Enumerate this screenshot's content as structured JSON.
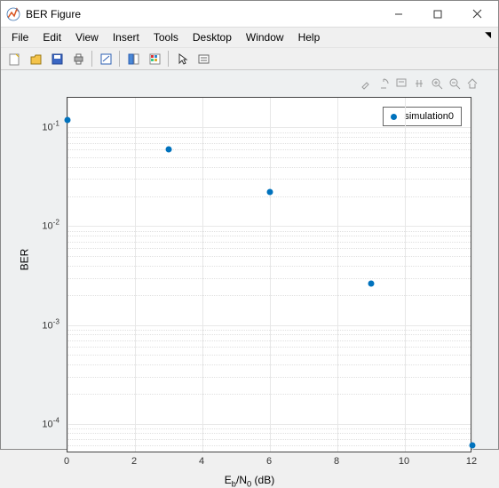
{
  "window": {
    "title": "BER Figure"
  },
  "menu": {
    "items": [
      "File",
      "Edit",
      "View",
      "Insert",
      "Tools",
      "Desktop",
      "Window",
      "Help"
    ]
  },
  "toolbar_icons": [
    "new-figure",
    "open",
    "save",
    "print",
    "edit-plot",
    "link-plot",
    "data-cursor",
    "arrow",
    "legend"
  ],
  "plot_tools": [
    "brush",
    "rotate",
    "datacursor",
    "pan",
    "zoom-in",
    "zoom-out",
    "home"
  ],
  "chart_data": {
    "type": "scatter",
    "title": "",
    "xlabel": "E_b/N_0 (dB)",
    "ylabel": "BER",
    "xlim": [
      0,
      12
    ],
    "ylim": [
      5e-05,
      0.2
    ],
    "yscale": "log",
    "xticks": [
      0,
      2,
      4,
      6,
      8,
      10,
      12
    ],
    "yticks": [
      0.0001,
      0.001,
      0.01,
      0.1
    ],
    "ytick_labels": [
      "10^-4",
      "10^-3",
      "10^-2",
      "10^-1"
    ],
    "series": [
      {
        "name": "simulation0",
        "color": "#0072bd",
        "x": [
          0,
          3,
          6,
          9,
          12
        ],
        "y": [
          0.12,
          0.06,
          0.022,
          0.0026,
          6e-05
        ]
      }
    ],
    "legend": {
      "position": "northeast",
      "entries": [
        "simulation0"
      ]
    }
  }
}
